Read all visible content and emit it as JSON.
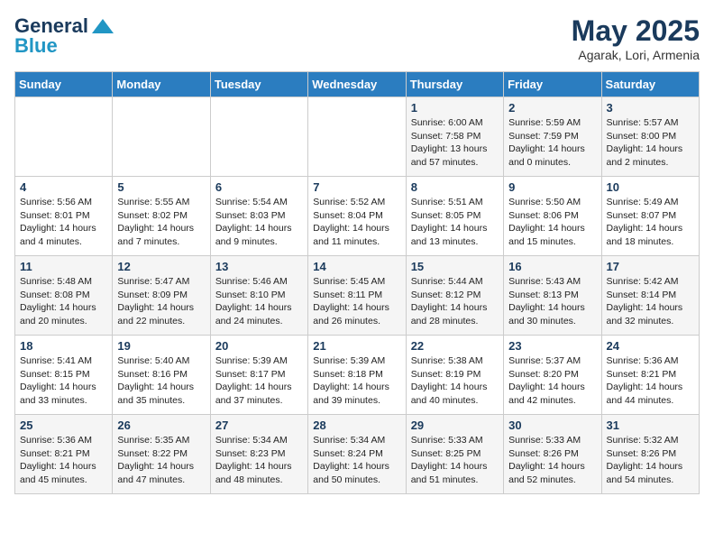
{
  "header": {
    "logo_general": "General",
    "logo_blue": "Blue",
    "month": "May 2025",
    "location": "Agarak, Lori, Armenia"
  },
  "days_of_week": [
    "Sunday",
    "Monday",
    "Tuesday",
    "Wednesday",
    "Thursday",
    "Friday",
    "Saturday"
  ],
  "weeks": [
    [
      {
        "day": "",
        "info": ""
      },
      {
        "day": "",
        "info": ""
      },
      {
        "day": "",
        "info": ""
      },
      {
        "day": "",
        "info": ""
      },
      {
        "day": "1",
        "info": "Sunrise: 6:00 AM\nSunset: 7:58 PM\nDaylight: 13 hours\nand 57 minutes."
      },
      {
        "day": "2",
        "info": "Sunrise: 5:59 AM\nSunset: 7:59 PM\nDaylight: 14 hours\nand 0 minutes."
      },
      {
        "day": "3",
        "info": "Sunrise: 5:57 AM\nSunset: 8:00 PM\nDaylight: 14 hours\nand 2 minutes."
      }
    ],
    [
      {
        "day": "4",
        "info": "Sunrise: 5:56 AM\nSunset: 8:01 PM\nDaylight: 14 hours\nand 4 minutes."
      },
      {
        "day": "5",
        "info": "Sunrise: 5:55 AM\nSunset: 8:02 PM\nDaylight: 14 hours\nand 7 minutes."
      },
      {
        "day": "6",
        "info": "Sunrise: 5:54 AM\nSunset: 8:03 PM\nDaylight: 14 hours\nand 9 minutes."
      },
      {
        "day": "7",
        "info": "Sunrise: 5:52 AM\nSunset: 8:04 PM\nDaylight: 14 hours\nand 11 minutes."
      },
      {
        "day": "8",
        "info": "Sunrise: 5:51 AM\nSunset: 8:05 PM\nDaylight: 14 hours\nand 13 minutes."
      },
      {
        "day": "9",
        "info": "Sunrise: 5:50 AM\nSunset: 8:06 PM\nDaylight: 14 hours\nand 15 minutes."
      },
      {
        "day": "10",
        "info": "Sunrise: 5:49 AM\nSunset: 8:07 PM\nDaylight: 14 hours\nand 18 minutes."
      }
    ],
    [
      {
        "day": "11",
        "info": "Sunrise: 5:48 AM\nSunset: 8:08 PM\nDaylight: 14 hours\nand 20 minutes."
      },
      {
        "day": "12",
        "info": "Sunrise: 5:47 AM\nSunset: 8:09 PM\nDaylight: 14 hours\nand 22 minutes."
      },
      {
        "day": "13",
        "info": "Sunrise: 5:46 AM\nSunset: 8:10 PM\nDaylight: 14 hours\nand 24 minutes."
      },
      {
        "day": "14",
        "info": "Sunrise: 5:45 AM\nSunset: 8:11 PM\nDaylight: 14 hours\nand 26 minutes."
      },
      {
        "day": "15",
        "info": "Sunrise: 5:44 AM\nSunset: 8:12 PM\nDaylight: 14 hours\nand 28 minutes."
      },
      {
        "day": "16",
        "info": "Sunrise: 5:43 AM\nSunset: 8:13 PM\nDaylight: 14 hours\nand 30 minutes."
      },
      {
        "day": "17",
        "info": "Sunrise: 5:42 AM\nSunset: 8:14 PM\nDaylight: 14 hours\nand 32 minutes."
      }
    ],
    [
      {
        "day": "18",
        "info": "Sunrise: 5:41 AM\nSunset: 8:15 PM\nDaylight: 14 hours\nand 33 minutes."
      },
      {
        "day": "19",
        "info": "Sunrise: 5:40 AM\nSunset: 8:16 PM\nDaylight: 14 hours\nand 35 minutes."
      },
      {
        "day": "20",
        "info": "Sunrise: 5:39 AM\nSunset: 8:17 PM\nDaylight: 14 hours\nand 37 minutes."
      },
      {
        "day": "21",
        "info": "Sunrise: 5:39 AM\nSunset: 8:18 PM\nDaylight: 14 hours\nand 39 minutes."
      },
      {
        "day": "22",
        "info": "Sunrise: 5:38 AM\nSunset: 8:19 PM\nDaylight: 14 hours\nand 40 minutes."
      },
      {
        "day": "23",
        "info": "Sunrise: 5:37 AM\nSunset: 8:20 PM\nDaylight: 14 hours\nand 42 minutes."
      },
      {
        "day": "24",
        "info": "Sunrise: 5:36 AM\nSunset: 8:21 PM\nDaylight: 14 hours\nand 44 minutes."
      }
    ],
    [
      {
        "day": "25",
        "info": "Sunrise: 5:36 AM\nSunset: 8:21 PM\nDaylight: 14 hours\nand 45 minutes."
      },
      {
        "day": "26",
        "info": "Sunrise: 5:35 AM\nSunset: 8:22 PM\nDaylight: 14 hours\nand 47 minutes."
      },
      {
        "day": "27",
        "info": "Sunrise: 5:34 AM\nSunset: 8:23 PM\nDaylight: 14 hours\nand 48 minutes."
      },
      {
        "day": "28",
        "info": "Sunrise: 5:34 AM\nSunset: 8:24 PM\nDaylight: 14 hours\nand 50 minutes."
      },
      {
        "day": "29",
        "info": "Sunrise: 5:33 AM\nSunset: 8:25 PM\nDaylight: 14 hours\nand 51 minutes."
      },
      {
        "day": "30",
        "info": "Sunrise: 5:33 AM\nSunset: 8:26 PM\nDaylight: 14 hours\nand 52 minutes."
      },
      {
        "day": "31",
        "info": "Sunrise: 5:32 AM\nSunset: 8:26 PM\nDaylight: 14 hours\nand 54 minutes."
      }
    ]
  ]
}
